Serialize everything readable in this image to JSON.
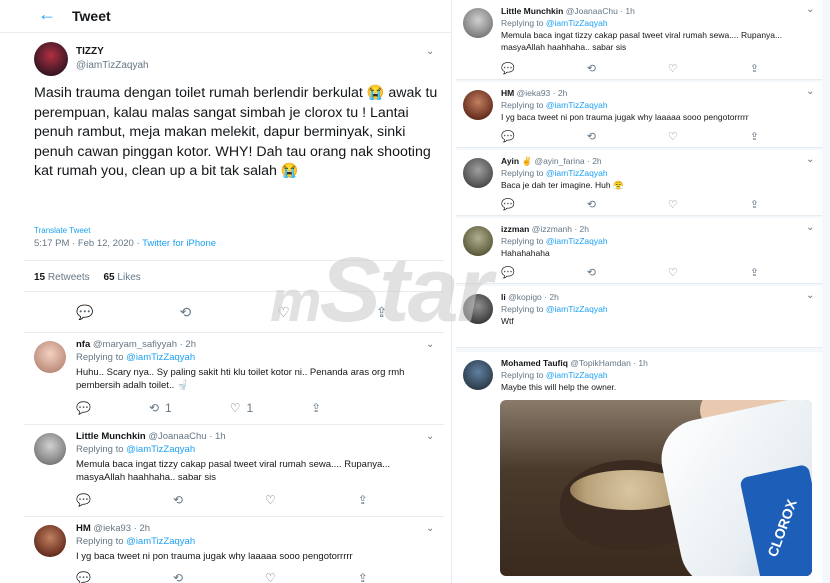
{
  "header": {
    "back_icon": "arrow-left-icon",
    "title": "Tweet"
  },
  "watermark": {
    "prefix": "m",
    "brand": "Star"
  },
  "main_tweet": {
    "name": "TIZZY",
    "handle": "@iamTizZaqyah",
    "text": "Masih trauma dengan toilet rumah berlendir berkulat 😭 awak tu perempuan, kalau malas sangat simbah je clorox tu ! Lantai penuh rambut, meja makan melekit, dapur berminyak, sinki penuh cawan pinggan kotor. WHY! Dah tau orang nak shooting kat rumah you, clean up a bit tak salah 😭",
    "translate": "Translate Tweet",
    "time": "5:17 PM · Feb 12, 2020 · ",
    "source": "Twitter for iPhone",
    "retweets": "15",
    "retweets_label": "Retweets",
    "likes": "65",
    "likes_label": "Likes"
  },
  "left_replies": [
    {
      "name": "nfa",
      "handle": "@maryam_safiyyah · 2h",
      "replying_prefix": "Replying to ",
      "replying_to": "@iamTizZaqyah",
      "text": "Huhu.. Scary nya.. Sy paling sakit hti klu toilet kotor ni.. Penanda aras org rmh pembersih adalh toilet.. 🚽",
      "retweets": "1",
      "likes": "1"
    },
    {
      "name": "Little Munchkin",
      "handle": "@JoanaaChu · 1h",
      "replying_prefix": "Replying to ",
      "replying_to": "@iamTizZaqyah",
      "text": "Memula baca ingat tizzy cakap pasal tweet viral rumah sewa.... Rupanya... masyaAllah haahhaha.. sabar sis"
    },
    {
      "name": "HM",
      "handle": "@ieka93 · 2h",
      "replying_prefix": "Replying to ",
      "replying_to": "@iamTizZaqyah",
      "text": "I yg baca tweet ni pon trauma jugak why laaaaa sooo pengotorrrrr"
    }
  ],
  "right_replies": [
    {
      "name": "Little Munchkin",
      "handle": "@JoanaaChu · 1h",
      "replying_prefix": "Replying to ",
      "replying_to": "@iamTizZaqyah",
      "text": "Memula baca ingat tizzy cakap pasal tweet viral rumah sewa.... Rupanya... masyaAllah haahhaha.. sabar sis"
    },
    {
      "name": "HM",
      "handle": "@ieka93 · 2h",
      "replying_prefix": "Replying to ",
      "replying_to": "@iamTizZaqyah",
      "text": "I yg baca tweet ni pon trauma jugak why laaaaa sooo pengotorrrrr"
    },
    {
      "name": "Ayin ✌",
      "handle": "@ayin_farina · 2h",
      "replying_prefix": "Replying to ",
      "replying_to": "@iamTizZaqyah",
      "text": "Baca je dah ter imagine. Huh 😤"
    },
    {
      "name": "izzman",
      "handle": "@izzmanh · 2h",
      "replying_prefix": "Replying to ",
      "replying_to": "@iamTizZaqyah",
      "text": "Hahahahaha"
    },
    {
      "name": "li",
      "handle": "@kopigo · 2h",
      "replying_prefix": "Replying to ",
      "replying_to": "@iamTizZaqyah",
      "text": "Wtf"
    },
    {
      "name": "Mohamed Taufiq",
      "handle": "@TopikHamdan · 1h",
      "replying_prefix": "Replying to ",
      "replying_to": "@iamTizZaqyah",
      "text": "Maybe this will help the owner."
    }
  ],
  "photo": {
    "label": "CLOROX"
  },
  "icons": {
    "reply": "reply-icon",
    "retweet": "retweet-icon",
    "like": "heart-icon",
    "share": "share-icon",
    "chevron": "chevron-down-icon"
  }
}
